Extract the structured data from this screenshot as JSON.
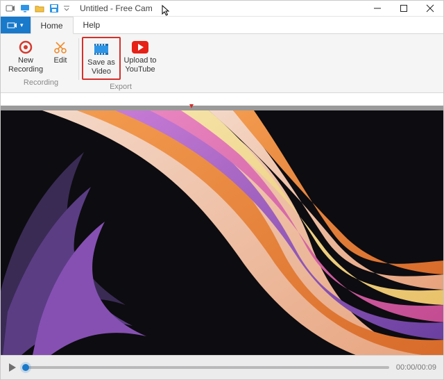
{
  "window": {
    "title": "Untitled - Free Cam"
  },
  "tabs": {
    "home": "Home",
    "help": "Help"
  },
  "ribbon": {
    "recording_group": "Recording",
    "export_group": "Export",
    "new_recording": "New Recording",
    "edit": "Edit",
    "save_as_video": "Save as Video",
    "upload_youtube": "Upload to YouTube"
  },
  "playback": {
    "current": "00:00",
    "total": "00:09"
  }
}
